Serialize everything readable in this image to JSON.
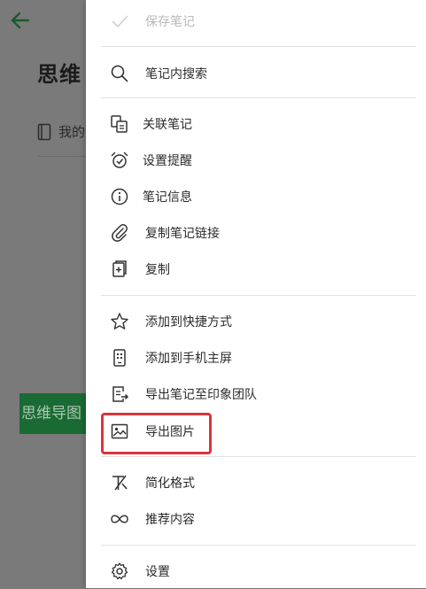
{
  "background": {
    "title": "思维",
    "notebook": "我的",
    "button_label": "思维导图"
  },
  "menu": {
    "save": "保存笔记",
    "search": "笔记内搜索",
    "related": "关联笔记",
    "reminder": "设置提醒",
    "info": "笔记信息",
    "copy_link": "复制笔记链接",
    "duplicate": "复制",
    "shortcut": "添加到快捷方式",
    "homescreen": "添加到手机主屏",
    "export_team": "导出笔记至印象团队",
    "export_image": "导出图片",
    "simplify": "简化格式",
    "recommend": "推荐内容",
    "settings": "设置"
  },
  "colors": {
    "accent_green": "#1a6b33",
    "highlight_red": "#d9353a"
  }
}
